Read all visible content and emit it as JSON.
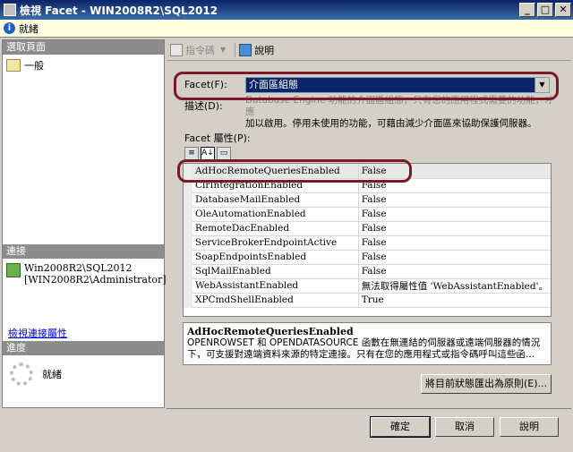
{
  "window": {
    "title": "檢視 Facet - WIN2008R2\\SQL2012",
    "minimize": "_",
    "maximize": "□",
    "close": "✕"
  },
  "status": {
    "text": "就緒"
  },
  "left": {
    "select_page_header": "選取頁面",
    "pages": [
      {
        "label": "一般",
        "icon": "properties-page-icon"
      }
    ],
    "connection_header": "連接",
    "connection": {
      "server": "Win2008R2\\SQL2012",
      "user": "[WIN2008R2\\Administrator]"
    },
    "view_connection_link": "檢視連接屬性",
    "progress_header": "進度",
    "progress_status": "就緒"
  },
  "toolbar": {
    "script_label": "指令碼",
    "help_label": "說明"
  },
  "facet": {
    "label": "Facet(F):",
    "selected": "介面區組態",
    "description_label": "描述(D):",
    "description_line1": "Database Engine 功能的介面區組態，只有您的應用程式需要的功能，才應",
    "description_line2": "加以啟用。停用未使用的功能，可藉由減少介面區來協助保護伺服器。"
  },
  "properties": {
    "label": "Facet 屬性(P):",
    "rows": [
      {
        "name": "AdHocRemoteQueriesEnabled",
        "value": "False"
      },
      {
        "name": "ClrIntegrationEnabled",
        "value": "False"
      },
      {
        "name": "DatabaseMailEnabled",
        "value": "False"
      },
      {
        "name": "OleAutomationEnabled",
        "value": "False"
      },
      {
        "name": "RemoteDacEnabled",
        "value": "False"
      },
      {
        "name": "ServiceBrokerEndpointActive",
        "value": "False"
      },
      {
        "name": "SoapEndpointsEnabled",
        "value": "False"
      },
      {
        "name": "SqlMailEnabled",
        "value": "False"
      },
      {
        "name": "WebAssistantEnabled",
        "value": "無法取得屬性值 'WebAssistantEnabled'。"
      },
      {
        "name": "XPCmdShellEnabled",
        "value": "True"
      }
    ]
  },
  "help": {
    "name": "AdHocRemoteQueriesEnabled",
    "line1": "OPENROWSET 和 OPENDATASOURCE 函數在無連結的伺服器或遠端伺服器的情況",
    "line2": "下，可支援對遠端資料來源的特定連接。只有在您的應用程式或指令碼呼叫這些函..."
  },
  "buttons": {
    "export": "將目前狀態匯出為原則(E)...",
    "ok": "確定",
    "cancel": "取消",
    "help": "說明"
  },
  "colors": {
    "highlight": "#7b1a26",
    "title_bar": "#0a246a"
  }
}
